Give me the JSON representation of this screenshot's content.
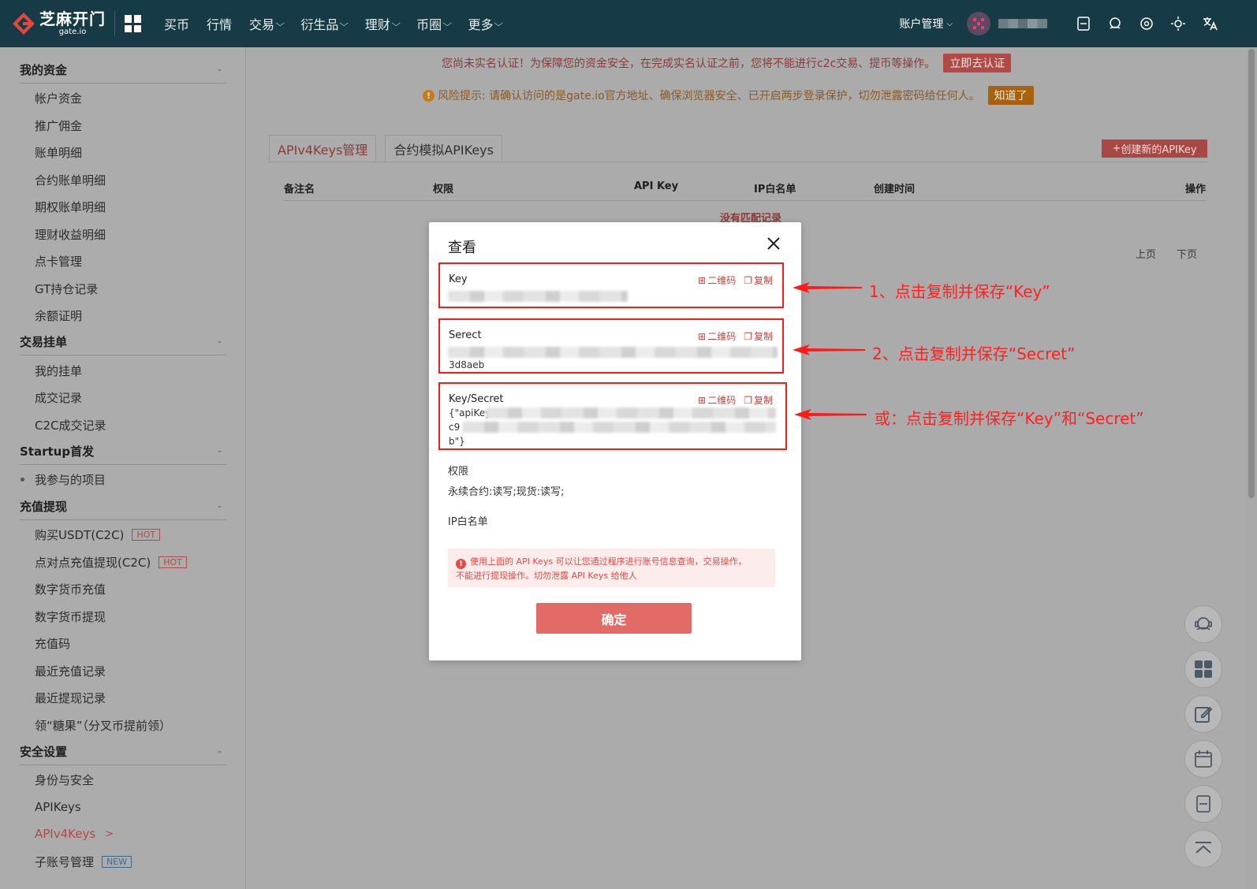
{
  "brand": {
    "cn": "芝麻开门",
    "en": "gate.io"
  },
  "nav": [
    {
      "label": "买币",
      "dropdown": false
    },
    {
      "label": "行情",
      "dropdown": false
    },
    {
      "label": "交易",
      "dropdown": true
    },
    {
      "label": "衍生品",
      "dropdown": true
    },
    {
      "label": "理财",
      "dropdown": true
    },
    {
      "label": "币圈",
      "dropdown": true
    },
    {
      "label": "更多",
      "dropdown": true
    }
  ],
  "account": {
    "label": "账户管理"
  },
  "sidebar": {
    "groups": [
      {
        "title": "我的资金",
        "items": [
          "帐户资金",
          "推广佣金",
          "账单明细",
          "合约账单明细",
          "期权账单明细",
          "理财收益明细",
          "点卡管理",
          "GT持仓记录",
          "余额证明"
        ]
      },
      {
        "title": "交易挂单",
        "items": [
          "我的挂单",
          "成交记录",
          "C2C成交记录"
        ]
      },
      {
        "title": "Startup首发",
        "items": [
          "我参与的项目"
        ]
      },
      {
        "title": "充值提现",
        "items": [
          "购买USDT(C2C)",
          "点对点充值提现(C2C)",
          "数字货币充值",
          "数字货币提现",
          "充值码",
          "最近充值记录",
          "最近提现记录",
          "领“糖果”（分叉币提前领）"
        ]
      },
      {
        "title": "安全设置",
        "items": [
          "身份与安全",
          "APIKeys",
          "APIv4Keys",
          "子账号管理"
        ]
      }
    ],
    "collapse_symbol": "-",
    "tags": {
      "hot": "HOT",
      "new": "NEW"
    },
    "active_arrow": ">"
  },
  "notices": {
    "kyc": "您尚未实名认证！为保障您的资金安全，在完成实名认证之前，您将不能进行c2c交易、提币等操作。",
    "kyc_button": "立即去认证",
    "risk": "风险提示: 请确认访问的是gate.io官方地址、确保浏览器安全、已开启两步登录保护，切勿泄露密码给任何人。",
    "risk_button": "知道了",
    "risk_icon": "!"
  },
  "tabs": [
    "APIv4Keys管理",
    "合约模拟APIKeys"
  ],
  "create_button": "创建新的APIKey",
  "create_icon": "+",
  "table": {
    "columns": [
      "备注名",
      "权限",
      "API Key",
      "IP白名单",
      "创建时间",
      "操作"
    ],
    "empty": "没有匹配记录"
  },
  "pager": {
    "prev": "上页",
    "next": "下页"
  },
  "modal": {
    "title": "查看",
    "qr_label": "二维码",
    "copy_label": "复制",
    "fields": [
      {
        "label": "Key",
        "visible_text": ""
      },
      {
        "label": "Serect",
        "visible_text": "3d8aeb"
      },
      {
        "label": "Key/Secret",
        "visible_lines": [
          "{\"apiKey",
          "c9",
          "b\"}"
        ]
      }
    ],
    "permissions_label": "权限",
    "permissions_value": "永续合约:读写;现货:读写;",
    "ip_label": "IP白名单",
    "warning_icon": "!",
    "warning_line1": "使用上面的 API Keys 可以让您通过程序进行账号信息查询，交易操作，",
    "warning_line2": "不能进行提现操作。切勿泄露 API Keys 给他人",
    "ok_button": "确定"
  },
  "annotations": [
    "1、点击复制并保存“Key”",
    "2、点击复制并保存“Secret”",
    "或：点击复制并保存“Key”和“Secret”"
  ],
  "colors": {
    "topbar": "#173b46",
    "accent_red": "#d23c36",
    "annotation_red": "#ff1a1a",
    "ok_button": "#e36b67",
    "overlay": "#ababab"
  }
}
